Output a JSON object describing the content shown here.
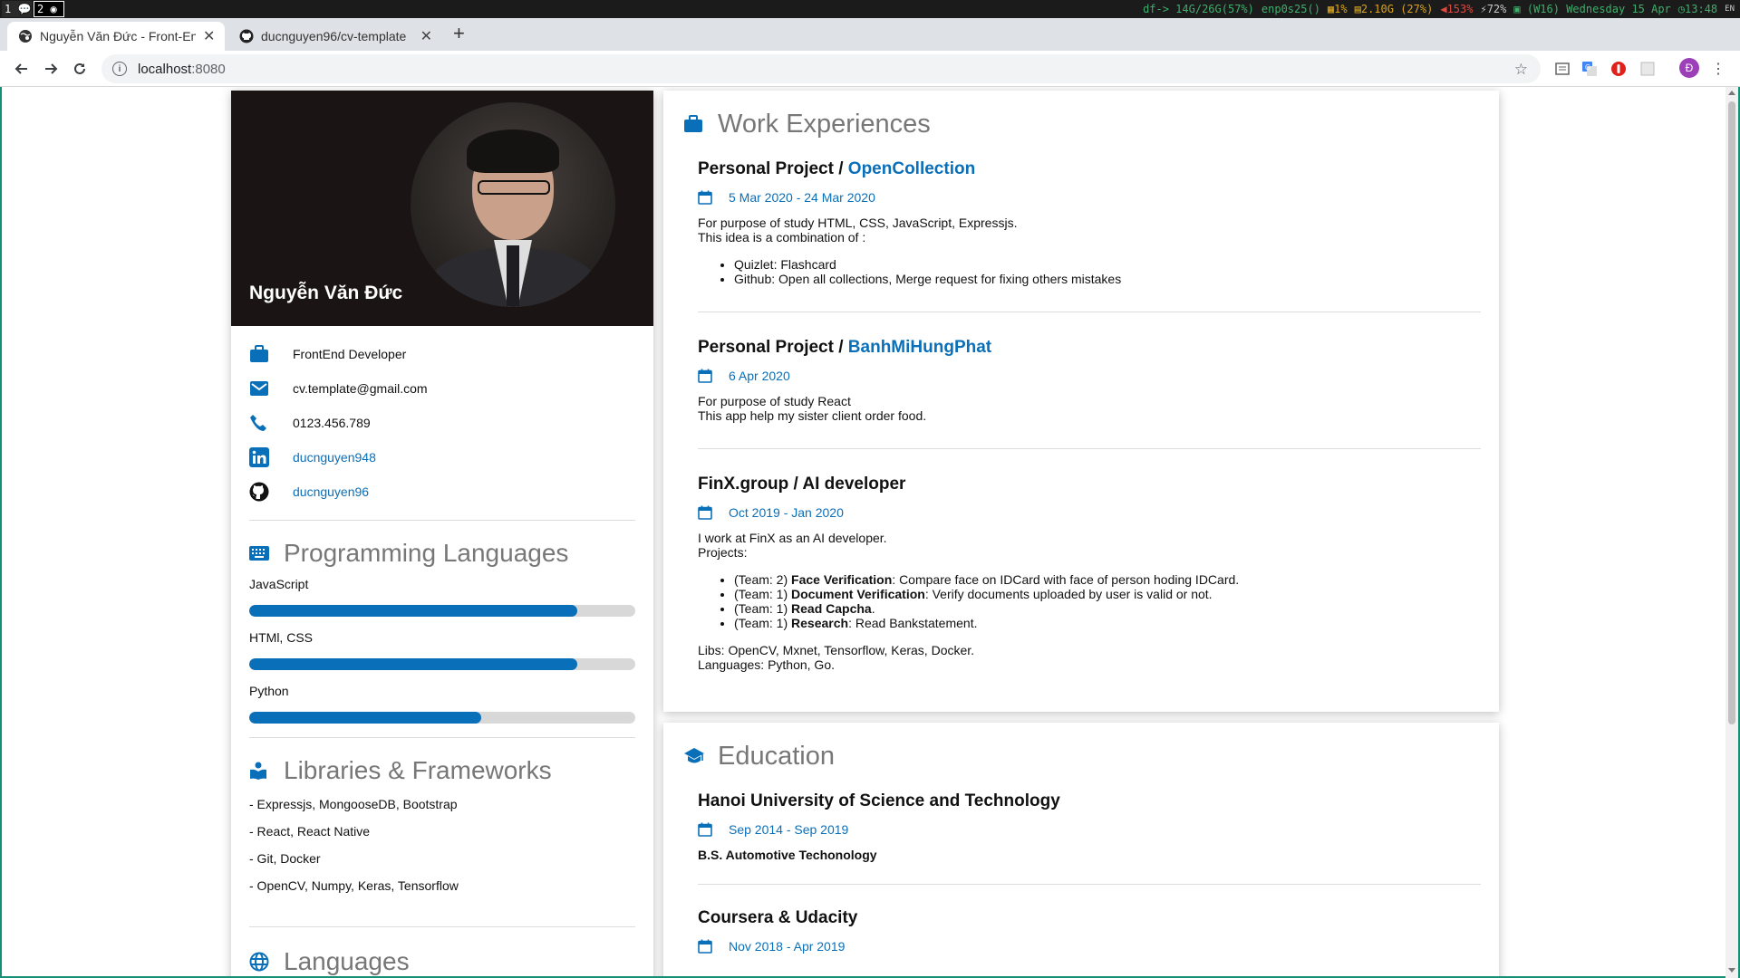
{
  "system_bar": {
    "ws1": "1",
    "ws2": "2",
    "disk": "df-> 14G/26G(57%)",
    "net": "enp0s25()",
    "cpu": "1%",
    "mem": "2.10G (27%)",
    "vol": "153%",
    "bat": "72%",
    "date": "(W16) Wednesday 15 Apr",
    "time": "13:48",
    "lang": "EN"
  },
  "browser": {
    "tabs": [
      {
        "title": "Nguyễn Văn Đức - Front-End Developer"
      },
      {
        "title": "ducnguyen96/cv-template"
      }
    ],
    "url_host": "localhost",
    "url_port": ":8080",
    "profile_initial": "Đ"
  },
  "profile": {
    "name": "Nguyễn Văn Đức",
    "contacts": [
      {
        "icon": "briefcase-icon",
        "text": "FrontEnd Developer",
        "link": false
      },
      {
        "icon": "mail-icon",
        "text": "cv.template@gmail.com",
        "link": false
      },
      {
        "icon": "phone-icon",
        "text": "0123.456.789",
        "link": false
      },
      {
        "icon": "linkedin-icon",
        "text": "ducnguyen948",
        "link": true
      },
      {
        "icon": "github-icon",
        "text": "ducnguyen96",
        "link": true
      }
    ]
  },
  "programming": {
    "title": "Programming Languages",
    "skills": [
      {
        "name": "JavaScript",
        "level": 0.85
      },
      {
        "name": "HTMl, CSS",
        "level": 0.85
      },
      {
        "name": "Python",
        "level": 0.6
      }
    ]
  },
  "libraries": {
    "title": "Libraries & Frameworks",
    "items": [
      "- Expressjs, MongooseDB, Bootstrap",
      "- React, React Native",
      "- Git, Docker",
      "- OpenCV, Numpy, Keras, Tensorflow"
    ]
  },
  "languages": {
    "title": "Languages"
  },
  "work": {
    "title": "Work Experiences",
    "entries": [
      {
        "org": "Personal Project / ",
        "project": "OpenCollection",
        "date": "5 Mar 2020 - 24 Mar 2020",
        "line1": "For purpose of study HTML, CSS, JavaScript, Expressjs.",
        "line2": "This idea is a combination of :",
        "bullets": [
          "Quizlet: Flashcard",
          "Github: Open all collections, Merge request for fixing others mistakes"
        ]
      },
      {
        "org": "Personal Project / ",
        "project": "BanhMiHungPhat",
        "date": "6 Apr 2020",
        "line1": "For purpose of study React",
        "line2": "This app help my sister client order food."
      },
      {
        "org": "FinX.group / AI developer",
        "date": "Oct 2019 - Jan 2020",
        "line1": "I work at FinX as an AI developer.",
        "line2": "Projects:",
        "projects": [
          {
            "team": "(Team: 2) ",
            "name": "Face Verification",
            "rest": ": Compare face on IDCard with face of person hoding IDCard."
          },
          {
            "team": "(Team: 1) ",
            "name": "Document Verification",
            "rest": ": Verify documents uploaded by user is valid or not."
          },
          {
            "team": "(Team: 1) ",
            "name": "Read Capcha",
            "rest": "."
          },
          {
            "team": "(Team: 1) ",
            "name": "Research",
            "rest": ": Read Bankstatement."
          }
        ],
        "libs": "Libs: OpenCV, Mxnet, Tensorflow, Keras, Docker.",
        "langs": "Languages: Python, Go."
      }
    ]
  },
  "education": {
    "title": "Education",
    "entries": [
      {
        "school": "Hanoi University of Science and Technology",
        "date": "Sep 2014 - Sep 2019",
        "degree": "B.S. Automotive Techonology"
      },
      {
        "school": "Coursera & Udacity",
        "date": "Nov 2018 - Apr 2019"
      }
    ]
  },
  "colors": {
    "accent": "#0a6fb9",
    "hero_bg": "#1a1414",
    "frame": "#168f77"
  }
}
